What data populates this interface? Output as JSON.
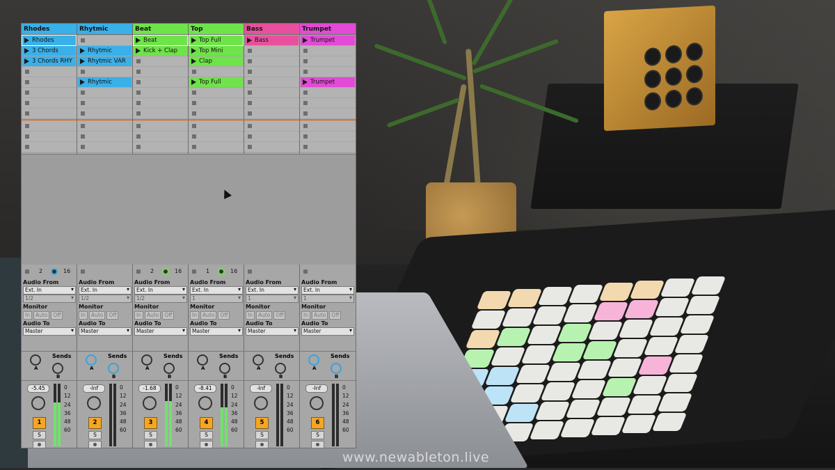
{
  "tracks": [
    {
      "name": "Rhodes",
      "color": "#3ab0e8",
      "clips": [
        {
          "label": "Rhodes",
          "color": "#3ab0e8",
          "playing": true
        },
        {
          "label": "3 Chords",
          "color": "#3ab0e8"
        },
        {
          "label": "3 Chords RHY",
          "color": "#3ab0e8"
        },
        null,
        null,
        null,
        null,
        null,
        null,
        null,
        null
      ],
      "info": {
        "left": "2",
        "right": "16"
      },
      "audio_from": "Ext. In",
      "channel": "1/2",
      "audio_to": "Master",
      "volume": "-5.45",
      "number": "1"
    },
    {
      "name": "Rhytmic",
      "color": "#3ab0e8",
      "clips": [
        null,
        {
          "label": "Rhytmic",
          "color": "#3ab0e8"
        },
        {
          "label": "Rhytmic VAR",
          "color": "#3ab0e8"
        },
        null,
        {
          "label": "Rhytmic",
          "color": "#3ab0e8"
        },
        null,
        null,
        null,
        null,
        null,
        null
      ],
      "info": {
        "left": "",
        "right": ""
      },
      "audio_from": "Ext. In",
      "channel": "1/2",
      "audio_to": "Master",
      "volume": "-Inf",
      "number": "2"
    },
    {
      "name": "Beat",
      "color": "#6fe34a",
      "clips": [
        {
          "label": "Beat",
          "color": "#6fe34a",
          "playing": true
        },
        {
          "label": "Kick + Clap",
          "color": "#6fe34a"
        },
        null,
        null,
        null,
        null,
        null,
        null,
        null,
        null,
        null
      ],
      "info": {
        "left": "2",
        "right": "16"
      },
      "audio_from": "Ext. In",
      "channel": "1/2",
      "audio_to": "Master",
      "volume": "-1.68",
      "number": "3"
    },
    {
      "name": "Top",
      "color": "#6fe34a",
      "clips": [
        {
          "label": "Top Full",
          "color": "#6fe34a",
          "playing": true
        },
        {
          "label": "Top Mini",
          "color": "#6fe34a"
        },
        {
          "label": "Clap",
          "color": "#6fe34a"
        },
        null,
        {
          "label": "Top Full",
          "color": "#6fe34a"
        },
        null,
        null,
        null,
        null,
        null,
        null
      ],
      "info": {
        "left": "1",
        "right": "16"
      },
      "audio_from": "Ext. In",
      "channel": "1",
      "audio_to": "Master",
      "volume": "-8.41",
      "number": "4"
    },
    {
      "name": "Bass",
      "color": "#e8509e",
      "clips": [
        {
          "label": "Bass",
          "color": "#e8509e"
        },
        null,
        null,
        null,
        null,
        null,
        null,
        null,
        null,
        null,
        null
      ],
      "info": {
        "left": "",
        "right": ""
      },
      "audio_from": "Ext. In",
      "channel": "1",
      "audio_to": "Master",
      "volume": "-Inf",
      "number": "5"
    },
    {
      "name": "Trumpet",
      "color": "#e34ad6",
      "clips": [
        {
          "label": "Trumpet",
          "color": "#e34ad6"
        },
        null,
        null,
        null,
        {
          "label": "Trumpet",
          "color": "#e34ad6"
        },
        null,
        null,
        null,
        null,
        null,
        null
      ],
      "info": {
        "left": "",
        "right": ""
      },
      "audio_from": "Ext. In",
      "channel": "1",
      "audio_to": "Master",
      "volume": "-Inf",
      "number": "6"
    }
  ],
  "labels": {
    "audio_from": "Audio From",
    "monitor": "Monitor",
    "audio_to": "Audio To",
    "sends": "Sends",
    "mon_in": "In",
    "mon_auto": "Auto",
    "mon_off": "Off",
    "send_a": "A",
    "send_b": "B",
    "solo": "S"
  },
  "meter_scale": [
    "0",
    "12",
    "24",
    "36",
    "48",
    "60"
  ],
  "meter_levels": [
    0.7,
    0,
    0.72,
    0.62,
    0,
    0
  ],
  "watermark": "www.newableton.live"
}
